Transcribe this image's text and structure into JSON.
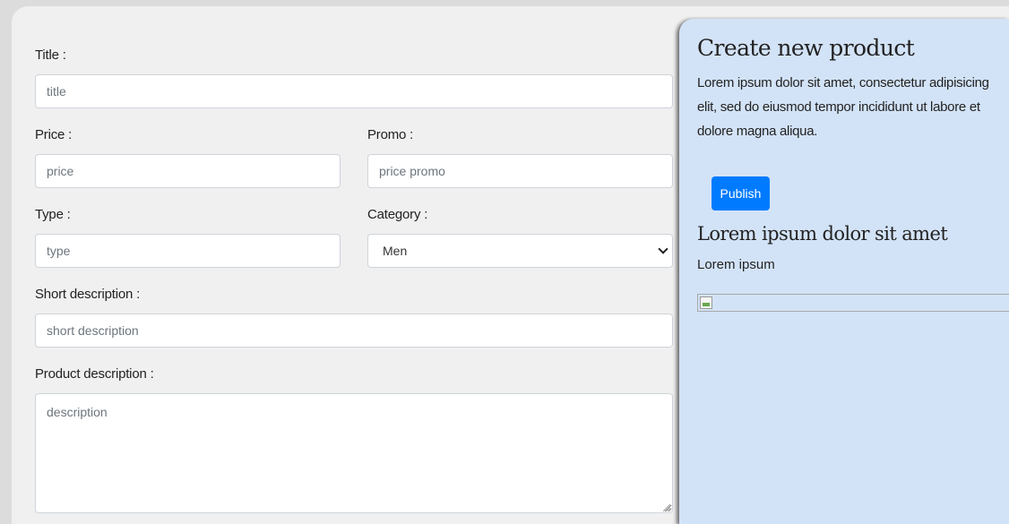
{
  "form": {
    "title_label": "Title :",
    "title_placeholder": "title",
    "price_label": "Price :",
    "price_placeholder": "price",
    "promo_label": "Promo :",
    "promo_placeholder": "price promo",
    "type_label": "Type :",
    "type_placeholder": "type",
    "category_label": "Category :",
    "category_selected": "Men",
    "short_desc_label": "Short description :",
    "short_desc_placeholder": "short description",
    "product_desc_label": "Product description :",
    "product_desc_placeholder": "description"
  },
  "panel": {
    "title": "Create new product",
    "description": "Lorem ipsum dolor sit amet, consectetur adipisicing elit, sed do eiusmod tempor incididunt ut labore et dolore magna aliqua.",
    "publish_label": "Publish",
    "preview_title": "Lorem ipsum dolor sit amet",
    "preview_subtitle": "Lorem ipsum",
    "accent_color": "#007bff",
    "background_color": "#d3e3f7",
    "image_icon": "broken-image-icon"
  }
}
